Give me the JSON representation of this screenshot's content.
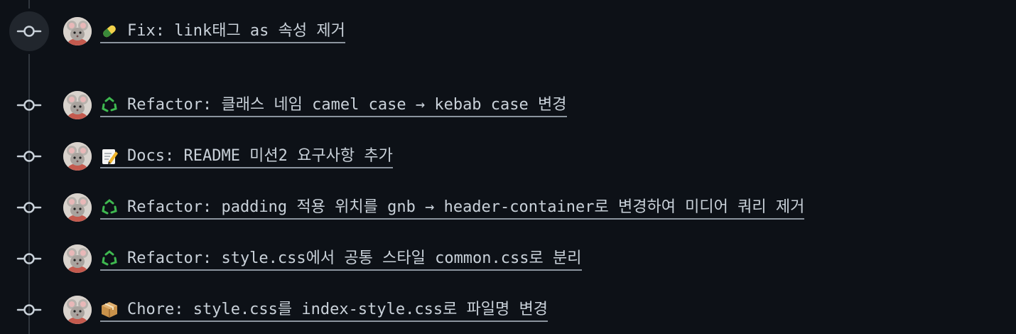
{
  "commits": [
    {
      "emoji": "pill-icon",
      "message": "Fix: link태그 as 속성 제거"
    },
    {
      "emoji": "recycle-icon",
      "message": "Refactor: 클래스 네임 camel case → kebab case 변경"
    },
    {
      "emoji": "memo-icon",
      "message": "Docs: README 미션2 요구사항 추가"
    },
    {
      "emoji": "recycle-icon",
      "message": "Refactor: padding 적용 위치를 gnb → header-container로 변경하여 미디어 쿼리 제거"
    },
    {
      "emoji": "recycle-icon",
      "message": "Refactor: style.css에서 공통 스타일 common.css로 분리"
    },
    {
      "emoji": "package-icon",
      "message": "Chore: style.css를 index-style.css로 파일명 변경"
    }
  ],
  "colors": {
    "background": "#0d1117",
    "timeline": "#30363d",
    "text": "#c9d1d9",
    "underline": "#8b949e",
    "node_highlight": "#21262d",
    "recycle_green": "#3fb950"
  }
}
